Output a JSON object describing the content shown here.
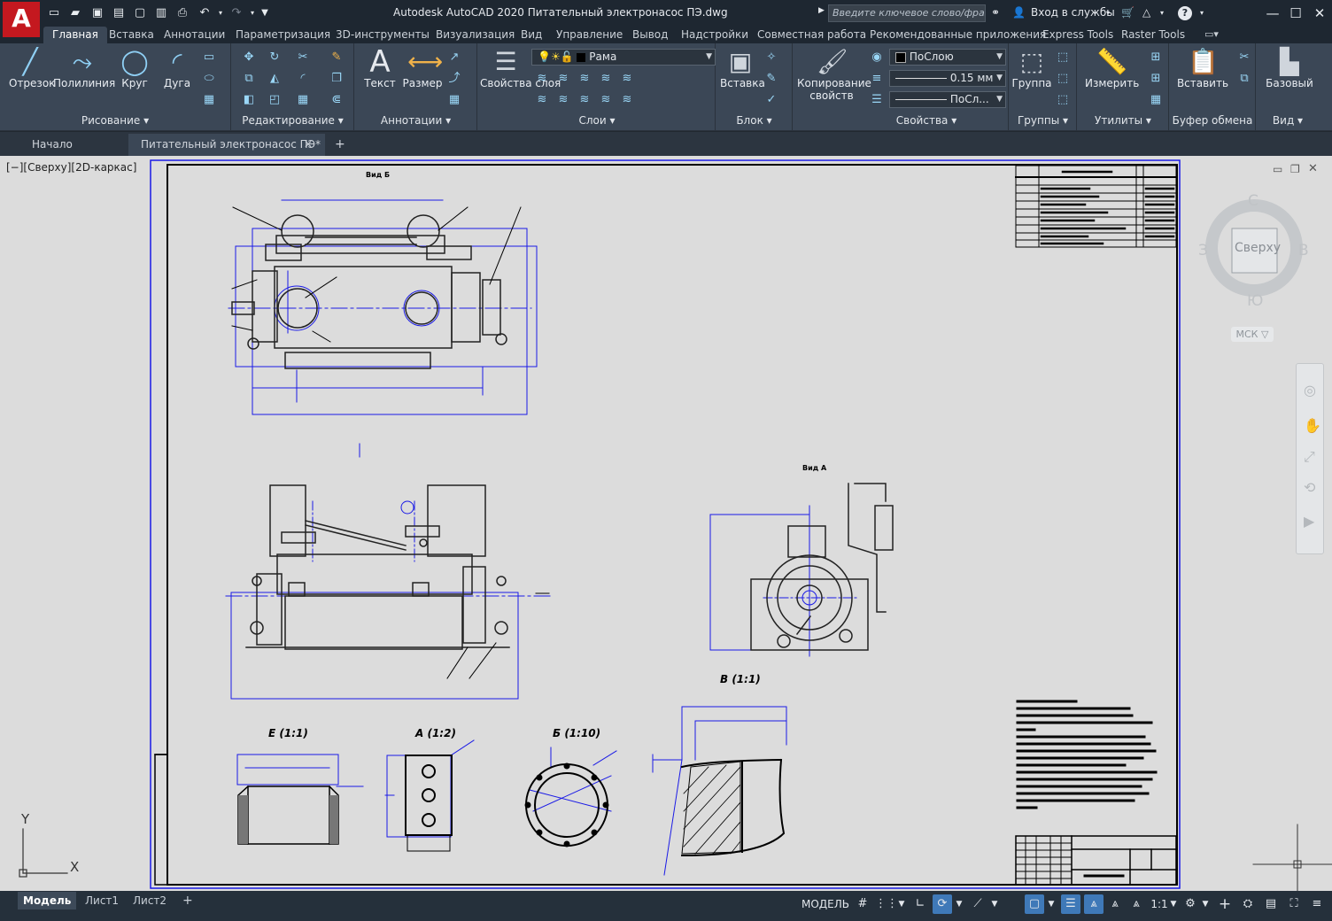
{
  "app": {
    "logo": "A",
    "title": "Autodesk AutoCAD 2020   Питательный электронасос ПЭ.dwg",
    "search_placeholder": "Введите ключевое слово/фразу",
    "signin": "Вход в службы",
    "help": "?"
  },
  "ribbon_tabs": [
    "Главная",
    "Вставка",
    "Аннотации",
    "Параметризация",
    "3D-инструменты",
    "Визуализация",
    "Вид",
    "Управление",
    "Вывод",
    "Надстройки",
    "Совместная работа",
    "Рекомендованные приложения",
    "Express Tools",
    "Raster Tools"
  ],
  "panels": {
    "draw": {
      "label": "Рисование",
      "tools": [
        "Отрезок",
        "Полилиния",
        "Круг",
        "Дуга"
      ]
    },
    "modify": {
      "label": "Редактирование"
    },
    "annotation": {
      "label": "Аннотации",
      "text": "Текст",
      "dimension": "Размер"
    },
    "layers": {
      "label": "Слои",
      "layer_props": "Свойства слоя",
      "current_layer": "Рама"
    },
    "block": {
      "label": "Блок",
      "insert": "Вставка"
    },
    "properties": {
      "label": "Свойства",
      "match": "Копирование свойств",
      "color": "ПоСлою",
      "lineweight": "0.15 мм",
      "linetype": "ПоСл..."
    },
    "groups": {
      "label": "Группы",
      "group": "Группа"
    },
    "utilities": {
      "label": "Утилиты",
      "measure": "Измерить"
    },
    "clipboard": {
      "label": "Буфер обмена",
      "paste": "Вставить"
    },
    "view": {
      "label": "Вид",
      "base": "Базовый"
    }
  },
  "doc_tabs": {
    "start": "Начало",
    "current": "Питательный электронасос ПЭ*"
  },
  "viewport": {
    "label": "[−][Сверху][2D-каркас]",
    "viewcube": {
      "face": "Сверху",
      "n": "С",
      "s": "Ю",
      "w": "З",
      "e": "В",
      "ucs": "МСК"
    }
  },
  "drawing_labels": {
    "view_b": "Вид Б",
    "view_a": "Вид А",
    "detail_v": "В (1:1)",
    "detail_e": "Е (1:1)",
    "detail_a": "А (1:2)",
    "detail_b": "Б (1:10)"
  },
  "ucs": {
    "x": "X",
    "y": "Y"
  },
  "layout_tabs": [
    "Модель",
    "Лист1",
    "Лист2"
  ],
  "status": {
    "model": "МОДЕЛЬ",
    "scale": "1:1"
  },
  "colors": {
    "accent": "#3f79b8",
    "cad_blue": "#1a1ae6",
    "paper": "#dcdcdc"
  }
}
